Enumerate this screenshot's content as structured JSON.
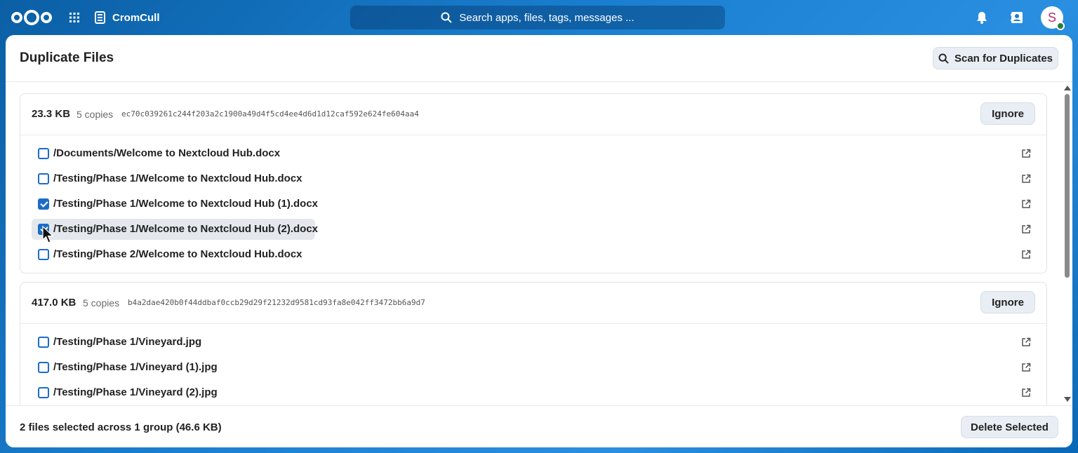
{
  "topbar": {
    "app_name": "CromCull",
    "search_placeholder": "Search apps, files, tags, messages ...",
    "avatar_initial": "S"
  },
  "page": {
    "title": "Duplicate Files",
    "scan_button": "Scan for Duplicates"
  },
  "groups": [
    {
      "size": "23.3 KB",
      "copies": "5 copies",
      "hash": "ec70c039261c244f203a2c1900a49d4f5cd4ee4d6d1d12caf592e624fe604aa4",
      "ignore_label": "Ignore",
      "files": [
        {
          "path": "/Documents/Welcome to Nextcloud Hub.docx",
          "checked": false
        },
        {
          "path": "/Testing/Phase 1/Welcome to Nextcloud Hub.docx",
          "checked": false
        },
        {
          "path": "/Testing/Phase 1/Welcome to Nextcloud Hub (1).docx",
          "checked": true
        },
        {
          "path": "/Testing/Phase 1/Welcome to Nextcloud Hub (2).docx",
          "checked": true
        },
        {
          "path": "/Testing/Phase 2/Welcome to Nextcloud Hub.docx",
          "checked": false
        }
      ]
    },
    {
      "size": "417.0 KB",
      "copies": "5 copies",
      "hash": "b4a2dae420b0f44ddbaf0ccb29d29f21232d9581cd93fa8e042ff3472bb6a9d7",
      "ignore_label": "Ignore",
      "files": [
        {
          "path": "/Testing/Phase 1/Vineyard.jpg",
          "checked": false
        },
        {
          "path": "/Testing/Phase 1/Vineyard (1).jpg",
          "checked": false
        },
        {
          "path": "/Testing/Phase 1/Vineyard (2).jpg",
          "checked": false
        }
      ]
    }
  ],
  "footer": {
    "selection_text": "2 files selected across 1 group (46.6 KB)",
    "delete_button": "Delete Selected"
  },
  "colors": {
    "accent": "#1c6cc7",
    "background_start": "#0b5fa5",
    "background_end": "#2a8fe0"
  },
  "icons": [
    "nextcloud-logo-icon",
    "apps-grid-icon",
    "app-icon",
    "search-icon",
    "bell-icon",
    "contacts-icon",
    "external-link-icon"
  ]
}
